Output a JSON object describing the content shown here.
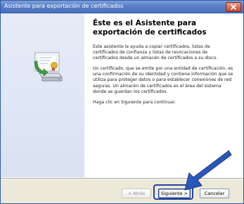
{
  "window": {
    "title": "Asistente para exportación de certificados"
  },
  "icons": {
    "close": "close-icon",
    "wizard": "certificate-export-icon",
    "pointer": "pointer-arrow"
  },
  "content": {
    "heading": "Éste es el Asistente para exportación de certificados",
    "paragraphs": [
      "Este asistente le ayuda a copiar certificados, listas de certificados de confianza y listas de revocaciones de certificados desde un almacén de certificados a su disco.",
      "Un certificado, que se emite por una entidad de certificación, es una confirmación de su identidad y contiene información que se utiliza para proteger datos o para establecer conexiones de red seguras. Un almacén de certificados es el área del sistema donde se guardan los certificados.",
      "Haga clic en Siguiente para continuar."
    ]
  },
  "buttons": {
    "back": "< Atrás",
    "next": "Siguiente >",
    "cancel": "Cancelar"
  },
  "colors": {
    "title_bar": "#5b80c8",
    "left_panel": "#e1e7f5",
    "annotation": "#2344a5"
  }
}
